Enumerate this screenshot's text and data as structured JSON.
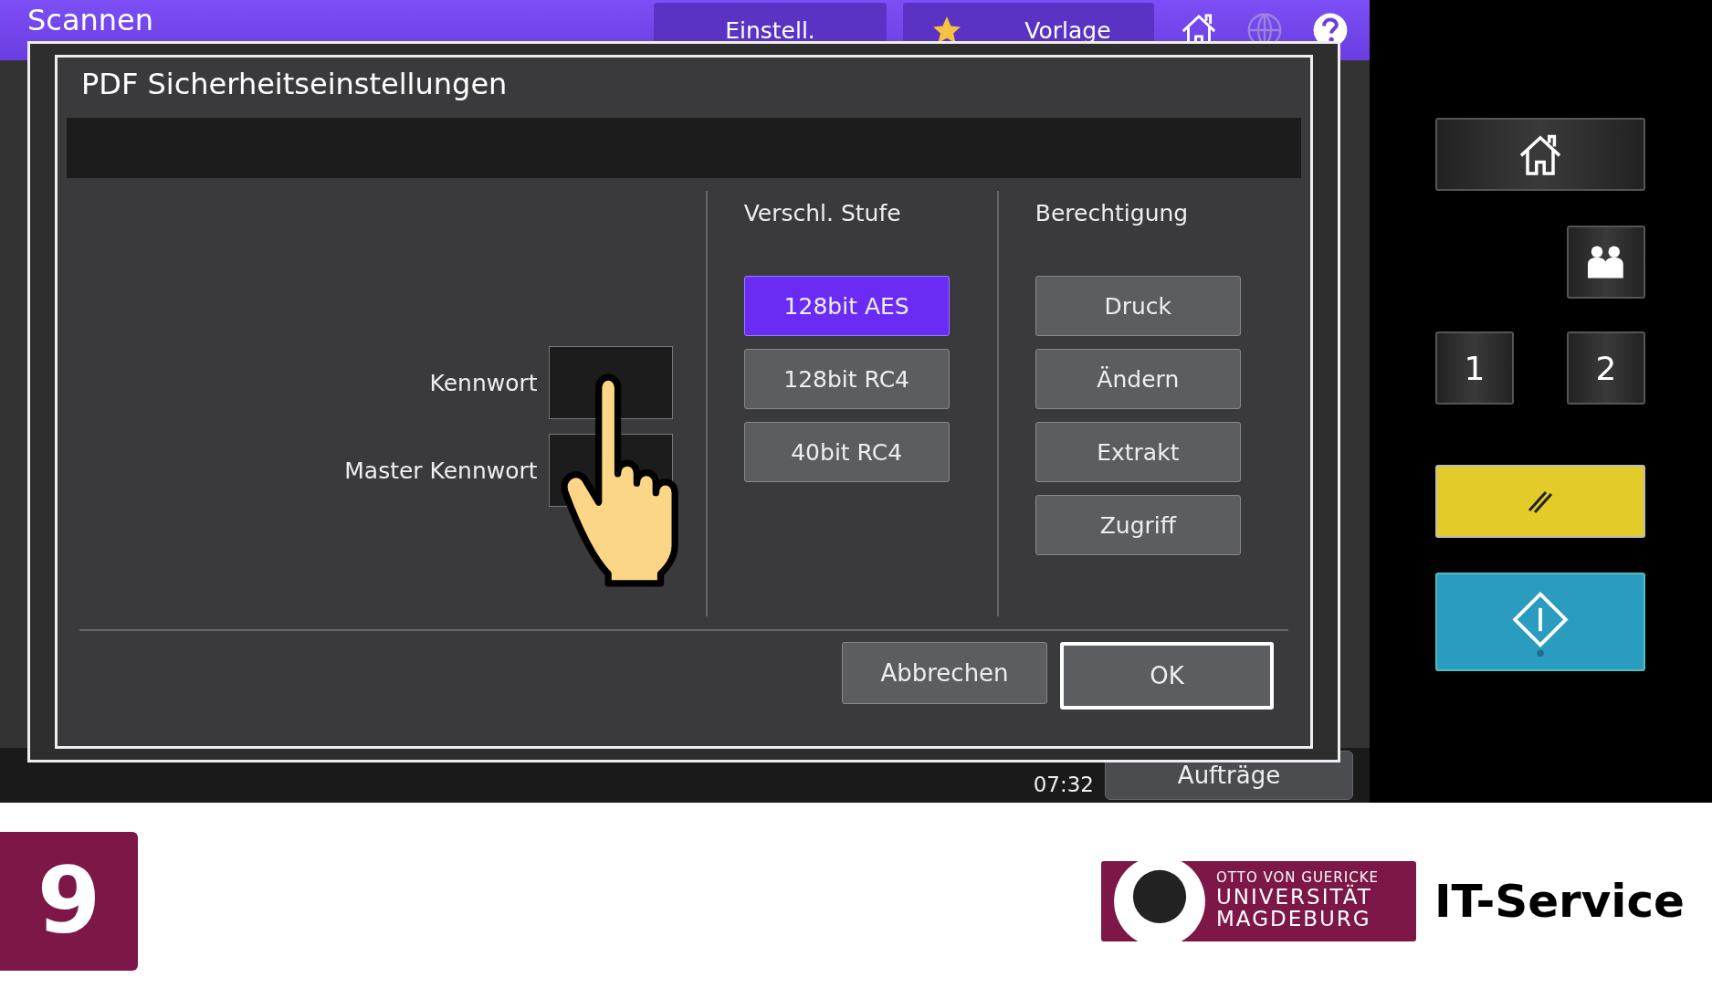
{
  "header": {
    "title": "Scannen",
    "tabs": [
      {
        "label": "Einstell.",
        "kind": "plain"
      },
      {
        "label": "Vorlage",
        "kind": "favorite"
      }
    ]
  },
  "dialog": {
    "title": "PDF Sicherheitseinstellungen",
    "fields": [
      {
        "label": "Kennwort"
      },
      {
        "label": "Master Kennwort"
      }
    ],
    "encryption": {
      "heading": "Verschl. Stufe",
      "options": [
        {
          "label": "128bit AES",
          "selected": true
        },
        {
          "label": "128bit RC4",
          "selected": false
        },
        {
          "label": "40bit RC4",
          "selected": false
        }
      ]
    },
    "permissions": {
      "heading": "Berechtigung",
      "options": [
        {
          "label": "Druck",
          "selected": false
        },
        {
          "label": "Ändern",
          "selected": false
        },
        {
          "label": "Extrakt",
          "selected": false
        },
        {
          "label": "Zugriff",
          "selected": false
        }
      ]
    },
    "buttons": [
      {
        "label": "Abbrechen",
        "focused": false
      },
      {
        "label": "OK",
        "focused": true
      }
    ]
  },
  "status": {
    "time": "07:32",
    "jobs_button": "Aufträge"
  },
  "side_panel": [
    {
      "kind": "home"
    },
    {
      "kind": "users"
    },
    {
      "kind": "number",
      "label": "1"
    },
    {
      "kind": "number",
      "label": "2"
    },
    {
      "kind": "reset"
    },
    {
      "kind": "start"
    }
  ],
  "footer": {
    "step": "9",
    "logo_lines": [
      "OTTO VON GUERICKE",
      "UNIVERSITÄT",
      "MAGDEBURG"
    ],
    "service": "IT-Service"
  }
}
